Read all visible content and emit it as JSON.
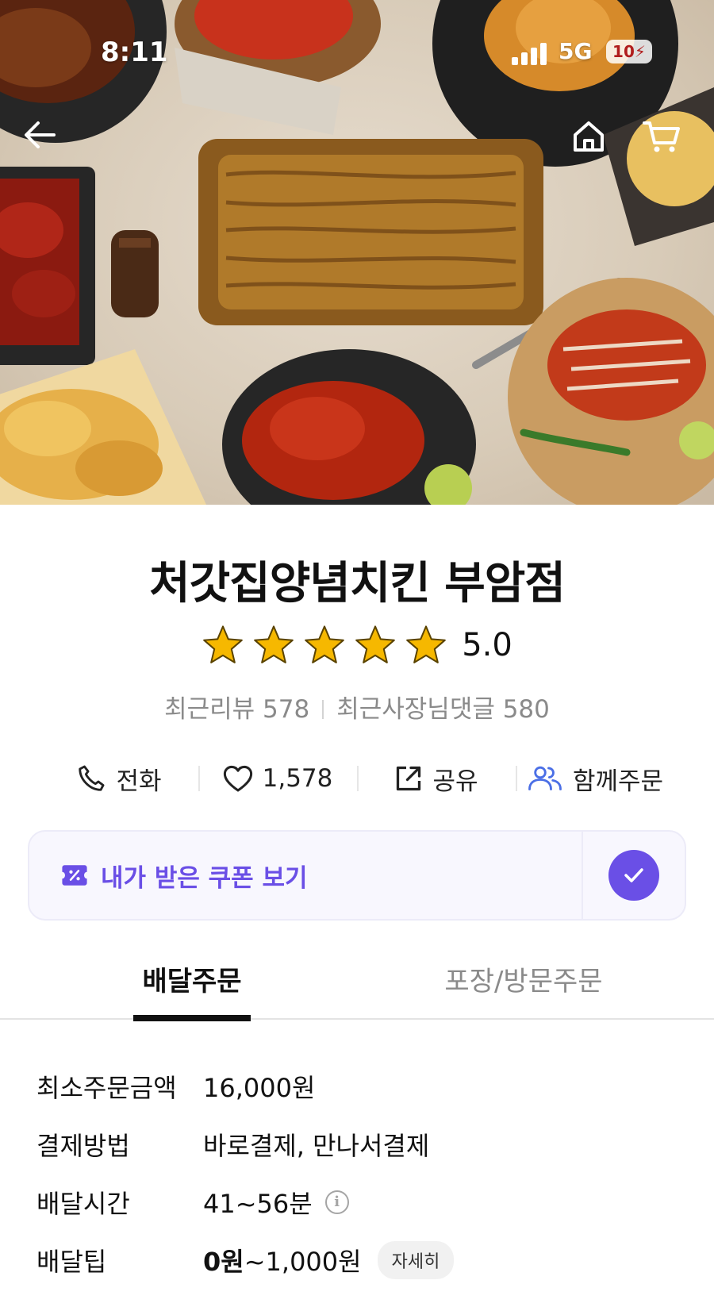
{
  "status_bar": {
    "time": "8:11",
    "network": "5G",
    "battery": "10"
  },
  "store": {
    "name": "처갓집양념치킨 부암점",
    "rating": "5.0",
    "stars": 5,
    "recent_reviews": "최근리뷰 578",
    "owner_replies": "최근사장님댓글 580"
  },
  "actions": {
    "call": "전화",
    "likes": "1,578",
    "share": "공유",
    "group_order": "함께주문"
  },
  "coupon": {
    "label": "내가 받은 쿠폰 보기"
  },
  "tabs": {
    "delivery": "배달주문",
    "pickup": "포장/방문주문"
  },
  "info": {
    "min_order_label": "최소주문금액",
    "min_order_value": "16,000원",
    "payment_label": "결제방법",
    "payment_value": "바로결제, 만나서결제",
    "delivery_time_label": "배달시간",
    "delivery_time_value": "41~56분",
    "delivery_tip_label": "배달팁",
    "delivery_tip_min": "0원",
    "delivery_tip_max": "~1,000원",
    "detail_button": "자세히"
  },
  "icons": [
    "back-arrow-icon",
    "home-icon",
    "cart-icon",
    "phone-icon",
    "heart-icon",
    "share-icon",
    "group-icon",
    "coupon-icon",
    "check-icon",
    "info-icon",
    "star-icon"
  ],
  "colors": {
    "accent": "#6a4fe6",
    "star": "#f6b800"
  }
}
